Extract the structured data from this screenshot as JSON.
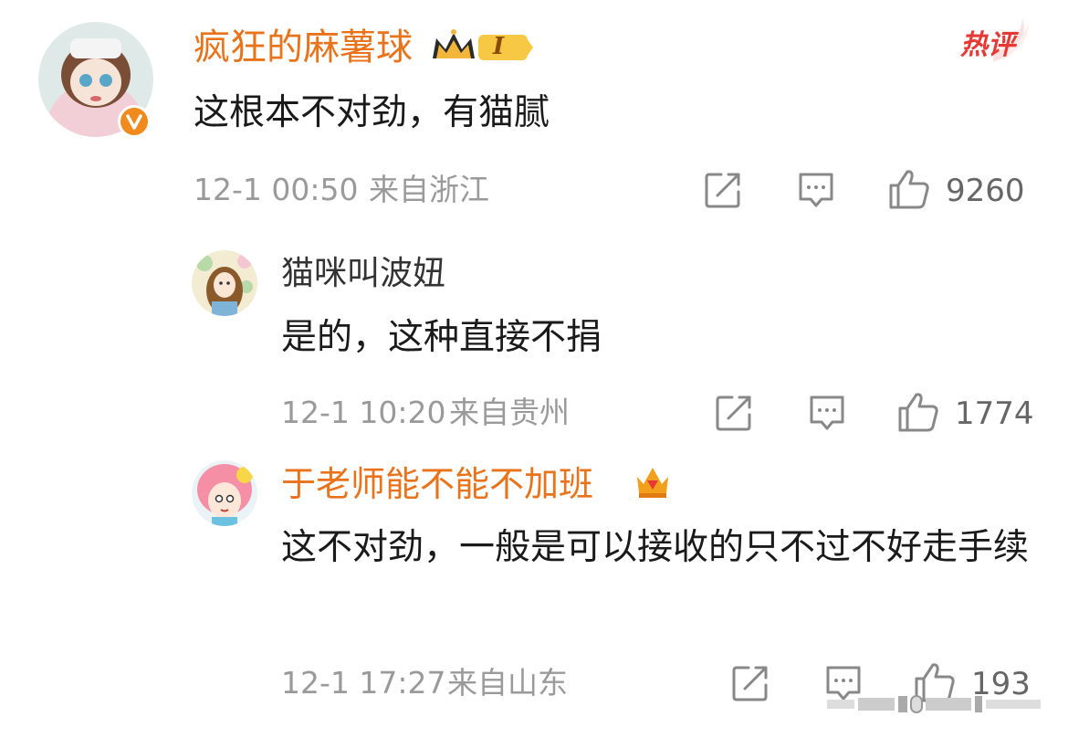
{
  "main_comment": {
    "username": "疯狂的麻薯球",
    "badge_level": "I",
    "hot_tag": "热评",
    "text": "这根本不对劲，有猫腻",
    "time": "12-1 00:50",
    "location": "来自浙江",
    "likes": "9260"
  },
  "replies": [
    {
      "username": "猫咪叫波妞",
      "text": "是的，这种直接不捐",
      "time": "12-1 10:20",
      "location": "来自贵州",
      "likes": "1774"
    },
    {
      "username": "于老师能不能不加班",
      "text": "这不对劲，一般是可以接收的只不过不好走手续",
      "time": "12-1 17:27",
      "location": "来自山东",
      "likes": "193"
    }
  ],
  "colors": {
    "accent_orange": "#e8731a",
    "meta_gray": "#9a9a9a",
    "hot_red": "#e53935"
  }
}
